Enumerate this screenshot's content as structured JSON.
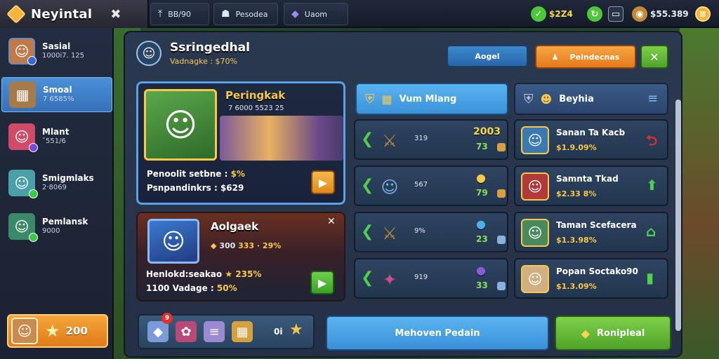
{
  "topbar": {
    "title": "Neyintal",
    "tabs": [
      {
        "label": "BB/90",
        "icon": "up-arrow-icon"
      },
      {
        "label": "Pesodea",
        "icon": "mask-icon"
      },
      {
        "label": "Uaom",
        "icon": "crystal-icon"
      }
    ],
    "resources": {
      "green_value": "$2Z4",
      "gold_value": "$55.389"
    }
  },
  "sidebar": {
    "items": [
      {
        "name": "Sasial",
        "sub": "1000i7. 125"
      },
      {
        "name": "Smoal",
        "sub": "7 6585%"
      },
      {
        "name": "Mlant",
        "sub": "ˇ551/6"
      },
      {
        "name": "Smigmlaks",
        "sub": "2·8069"
      },
      {
        "name": "Pemlansk",
        "sub": "9000"
      }
    ],
    "profile_value": "200"
  },
  "panel": {
    "title": "Ssringedhal",
    "subtitle": "Vadnagke : $70%",
    "btn_blue": "Aogel",
    "btn_orange": "Peindecnas",
    "close": "✕"
  },
  "card1": {
    "title": "Peringkak",
    "small": "7 6000 5523 25",
    "line1_label": "Penoolit setbne :",
    "line1_value": "$%",
    "line2_label": "Psnpandinkrs :",
    "line2_value": "$629"
  },
  "card2": {
    "title": "Aolgaek",
    "small_pre": "300",
    "small_val": "333 · 29%",
    "line1_label": "Henlokd:seakao",
    "line1_value": "★ 235%",
    "line2_label": "1100 Vadage :",
    "line2_value": "50%"
  },
  "strip": {
    "notif": "9",
    "count": "0i"
  },
  "middle": {
    "tab_label": "Vum Mlang",
    "rows": [
      {
        "mid": "319",
        "val1": "2003",
        "val2": "73"
      },
      {
        "mid": "567",
        "val1": "",
        "val2": "79"
      },
      {
        "mid": "9%",
        "val1": "",
        "val2": "23"
      },
      {
        "mid": "919",
        "val1": "",
        "val2": "33"
      }
    ]
  },
  "right": {
    "tab_label": "Beyhia",
    "rows": [
      {
        "name": "Sanan Ta Kacb",
        "price": "$1.9.09%"
      },
      {
        "name": "Samnta Tkad",
        "price": "$2.33 8%"
      },
      {
        "name": "Taman Scefacera",
        "price": "$1.3.98%"
      },
      {
        "name": "Popan Soctako90",
        "price": "$1.3.09%"
      }
    ]
  },
  "bottom": {
    "blue_label": "Mehoven Pedain",
    "green_label": "Ronipleal"
  }
}
